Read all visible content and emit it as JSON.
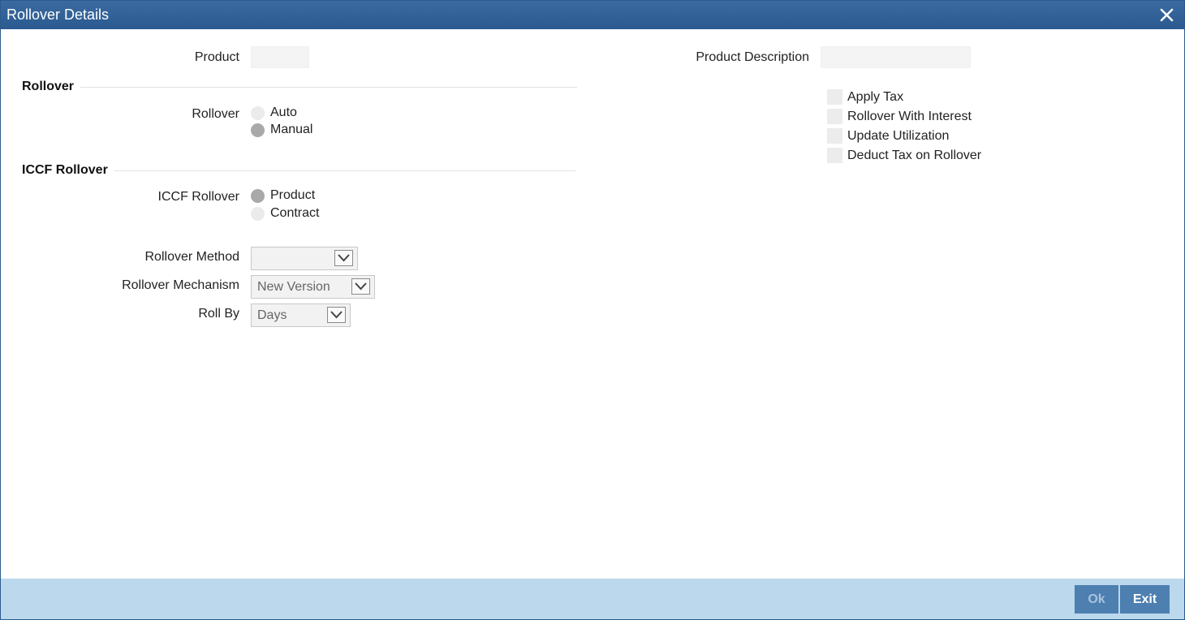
{
  "window": {
    "title": "Rollover Details",
    "close_icon": "close-icon"
  },
  "product": {
    "label": "Product",
    "value": "",
    "description_label": "Product Description",
    "description_value": ""
  },
  "rollover_section": {
    "title": "Rollover",
    "field_label": "Rollover",
    "options": [
      {
        "label": "Auto",
        "checked": false
      },
      {
        "label": "Manual",
        "checked": true
      }
    ]
  },
  "iccf_section": {
    "title": "ICCF Rollover",
    "field_label": "ICCF Rollover",
    "options": [
      {
        "label": "Product",
        "checked": true
      },
      {
        "label": "Contract",
        "checked": false
      }
    ]
  },
  "checkboxes": [
    {
      "label": "Apply Tax",
      "checked": false
    },
    {
      "label": "Rollover With Interest",
      "checked": false
    },
    {
      "label": "Update Utilization",
      "checked": false
    },
    {
      "label": "Deduct Tax on Rollover",
      "checked": false
    }
  ],
  "selects": {
    "rollover_method": {
      "label": "Rollover Method",
      "value": ""
    },
    "rollover_mechanism": {
      "label": "Rollover Mechanism",
      "value": "New Version"
    },
    "roll_by": {
      "label": "Roll By",
      "value": "Days"
    }
  },
  "footer": {
    "ok_label": "Ok",
    "exit_label": "Exit"
  },
  "colors": {
    "titlebar": "#2f5f94",
    "footer": "#bcd8ec",
    "button": "#4d7fb0"
  }
}
